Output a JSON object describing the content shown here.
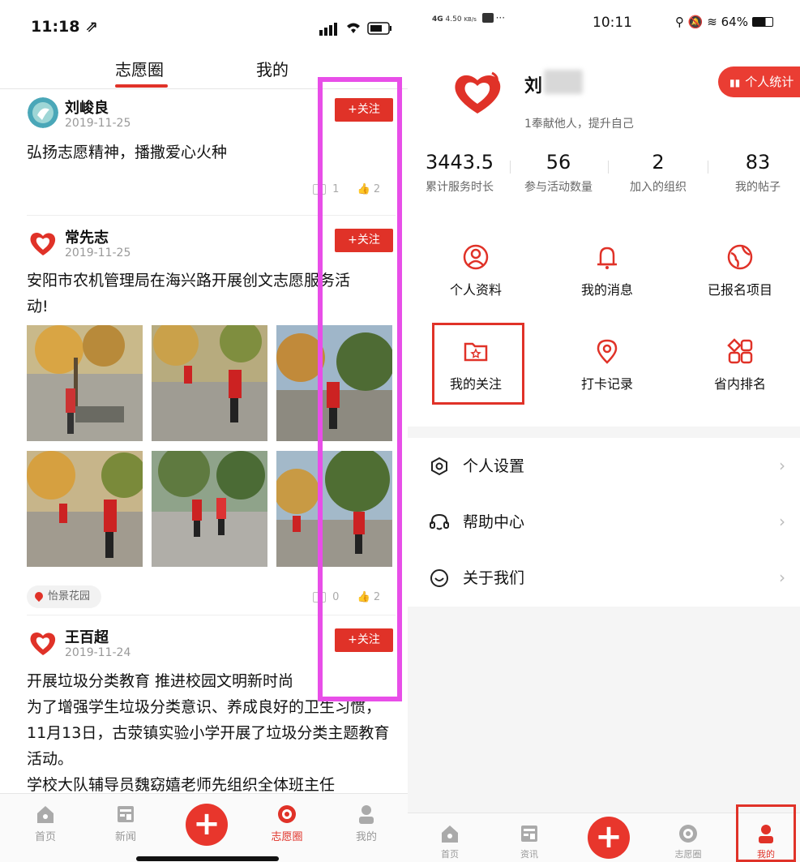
{
  "left": {
    "status": {
      "time": "11:18 ⇗"
    },
    "tabs": [
      "志愿圈",
      "我的"
    ],
    "posts": [
      {
        "user": "刘峻良",
        "date": "2019-11-25",
        "follow": "+关注",
        "text": "弘扬志愿精神，播撒爱心火种",
        "comments": "1",
        "likes": "2"
      },
      {
        "user": "常先志",
        "date": "2019-11-25",
        "follow": "+关注",
        "text": "安阳市农机管理局在海兴路开展创文志愿服务活动!",
        "location": "怡景花园",
        "comments": "0",
        "likes": "2"
      },
      {
        "user": "王百超",
        "date": "2019-11-24",
        "follow": "+关注",
        "text": "开展垃圾分类教育 推进校园文明新时尚\n为了增强学生垃圾分类意识、养成良好的卫生习惯，11月13日，古荥镇实验小学开展了垃圾分类主题教育活动。\n学校大队辅导员魏窈嬉老师先组织全体班主任"
      }
    ],
    "nav": [
      "首页",
      "新闻",
      "志愿圈",
      "我的"
    ],
    "plus": "+"
  },
  "right": {
    "status": {
      "net": "4G",
      "speed": "4.50",
      "speed_unit": "KB/s",
      "time": "10:11",
      "battery": "64%"
    },
    "profile": {
      "name": "刘",
      "motto": "1奉献他人，提升自己",
      "stat_button": "个人统计"
    },
    "stats": [
      {
        "value": "3443.5",
        "label": "累计服务时长"
      },
      {
        "value": "56",
        "label": "参与活动数量"
      },
      {
        "value": "2",
        "label": "加入的组织"
      },
      {
        "value": "83",
        "label": "我的帖子"
      }
    ],
    "grid": [
      "个人资料",
      "我的消息",
      "已报名项目",
      "我的关注",
      "打卡记录",
      "省内排名"
    ],
    "menu": [
      "个人设置",
      "帮助中心",
      "关于我们"
    ],
    "nav": [
      "首页",
      "资讯",
      "志愿圈",
      "我的"
    ],
    "plus": "+",
    "colors": {
      "accent": "#e03228",
      "highlight": "#e84ee8"
    }
  }
}
